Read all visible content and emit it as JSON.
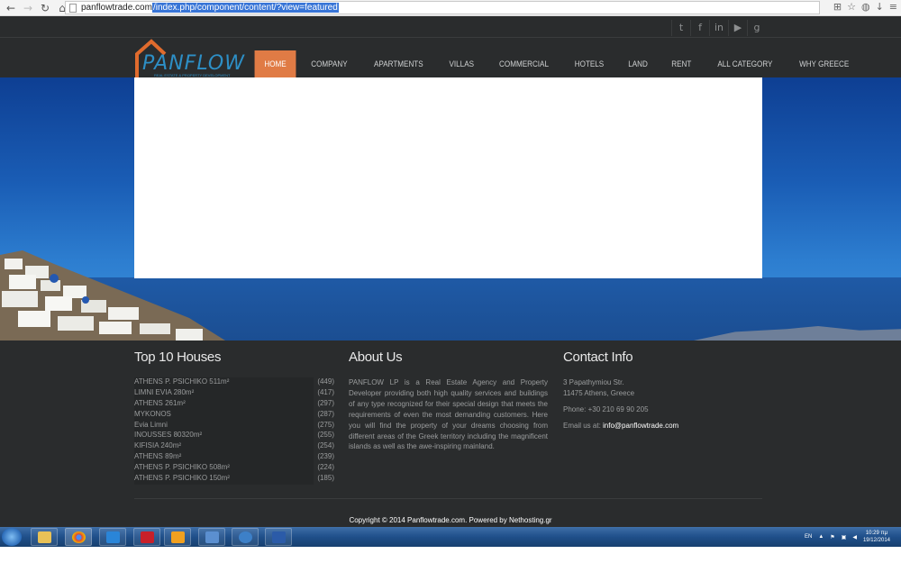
{
  "browser": {
    "url_host": "panflowtrade.com",
    "url_path": "/index.php/component/content/?view=featured"
  },
  "social_icons": [
    "twitter-icon",
    "facebook-icon",
    "linkedin-icon",
    "youtube-icon",
    "google-plus-icon"
  ],
  "logo": {
    "name": "PANFLOW",
    "tagline": "REAL ESTATE & PROPERTY DEVELOPMENT"
  },
  "menu": [
    {
      "label": "HOME"
    },
    {
      "label": "COMPANY"
    },
    {
      "label": "APARTMENTS"
    },
    {
      "label": "VILLAS"
    },
    {
      "label": "COMMERCIAL"
    },
    {
      "label": "HOTELS"
    },
    {
      "label": "LAND"
    },
    {
      "label": "RENT"
    },
    {
      "label": "ALL CATEGORY"
    },
    {
      "label": "WHY GREECE"
    }
  ],
  "colors": {
    "accent": "#e07b45",
    "footer_bg": "#2a2c2d",
    "logo_blue": "#2d8fc6"
  },
  "footer": {
    "houses_title": "Top 10 Houses",
    "houses": [
      {
        "name": "ATHENS P. PSICHIKO 511m²",
        "count": "(449)"
      },
      {
        "name": "LIMNI EVIA 280m²",
        "count": "(417)"
      },
      {
        "name": "ATHENS 261m²",
        "count": "(297)"
      },
      {
        "name": "MYKONOS",
        "count": "(287)"
      },
      {
        "name": "Evia Limni",
        "count": "(275)"
      },
      {
        "name": "INOUSSES 80320m²",
        "count": "(255)"
      },
      {
        "name": "KIFISIA 240m²",
        "count": "(254)"
      },
      {
        "name": "ATHENS 89m²",
        "count": "(239)"
      },
      {
        "name": "ATHENS P. PSICHIKO 508m²",
        "count": "(224)"
      },
      {
        "name": "ATHENS P. PSICHIKO 150m²",
        "count": "(185)"
      }
    ],
    "about_title": "About Us",
    "about_text": "PANFLOW LP is a Real Estate Agency and Property Developer providing both high quality services and buildings of any type recognized for their special design that meets the requirements of even the most demanding customers. Here you will find the property of your dreams choosing from different areas of the Greek territory including the magnificent islands as well as the awe-inspiring mainland.",
    "contact_title": "Contact Info",
    "address_line1": "3 Papathymiou Str.",
    "address_line2": "11475 Athens, Greece",
    "phone": "Phone: +30 210 69 90 205",
    "email_label": "Email us at:",
    "email": "info@panflowtrade.com",
    "copyright": "Copyright © 2014 Panflowtrade.com. Powered by Nethosting.gr"
  },
  "taskbar": {
    "apps": [
      "explorer-icon",
      "chrome-icon",
      "dropbox-icon",
      "acrobat-icon",
      "outlook-icon",
      "home-app-icon",
      "ie-icon",
      "word-icon"
    ],
    "lang": "EN",
    "time": "10:29 πμ",
    "date": "19/12/2014"
  }
}
